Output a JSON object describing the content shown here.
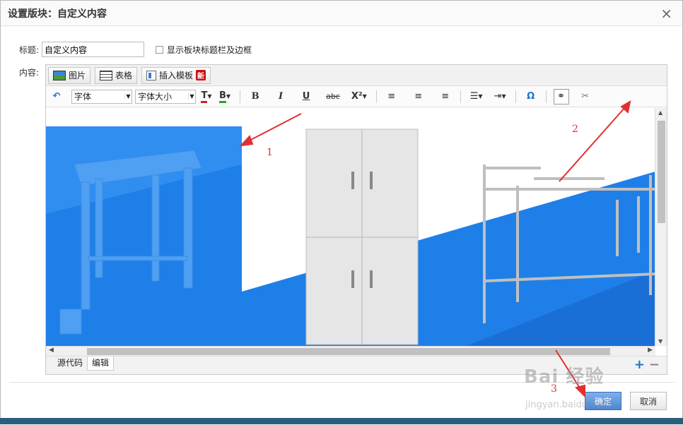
{
  "dialog": {
    "title": "设置版块：自定义内容",
    "close_label": "×"
  },
  "form": {
    "title_label": "标题:",
    "title_value": "自定义内容",
    "show_border_label": "显示板块标题栏及边框",
    "content_label": "内容:"
  },
  "insert_bar": {
    "image_label": "图片",
    "table_label": "表格",
    "template_label": "插入模板",
    "new_badge": "新"
  },
  "toolbar": {
    "undo_icon": "↶",
    "font_label": "字体",
    "font_size_label": "字体大小",
    "text_color_label": "T",
    "bg_color_label": "B",
    "bold": "B",
    "italic": "I",
    "underline": "U",
    "strike": "abc",
    "superscript": "X²",
    "special_char": "Ω"
  },
  "editor_tabs": {
    "source_label": "源代码",
    "edit_label": "编辑"
  },
  "zoom": {
    "plus": "+",
    "minus": "−"
  },
  "buttons": {
    "ok_label": "确定",
    "cancel_label": "取消"
  },
  "annotations": {
    "a1": "1",
    "a2": "2",
    "a3": "3"
  },
  "watermark": {
    "text": "Bai 经验",
    "url": "jingyan.baidu.com"
  },
  "colors": {
    "accent": "#1a73d4",
    "arrow": "#e03030",
    "image_blue": "#1f7fe8"
  }
}
